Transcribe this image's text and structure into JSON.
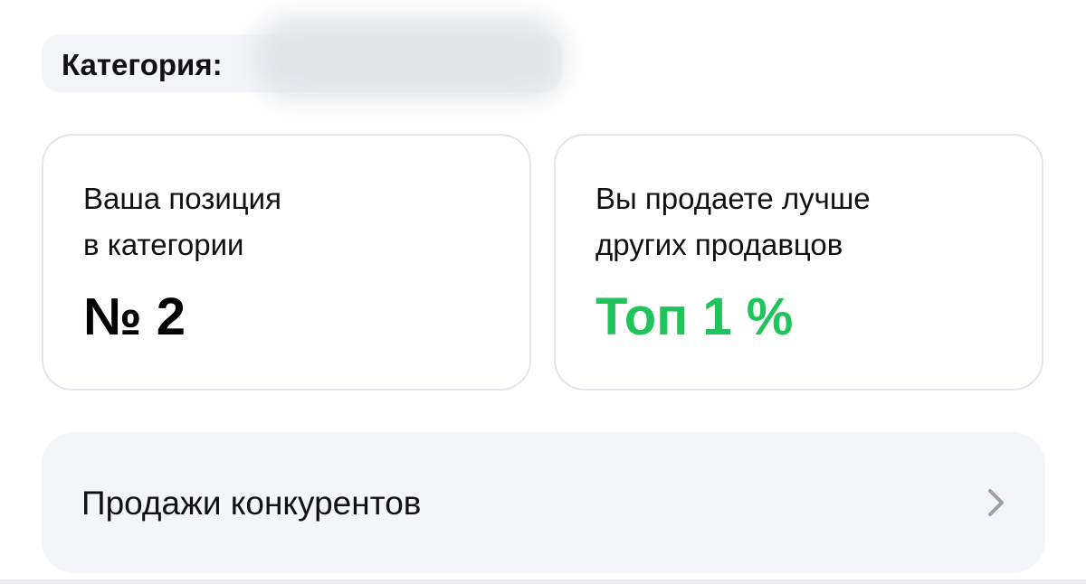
{
  "category": {
    "label": "Категория:"
  },
  "cards": [
    {
      "caption": "Ваша позиция\nв категории",
      "value": "№ 2"
    },
    {
      "caption": "Вы продаете лучше\nдругих продавцов",
      "value": "Топ 1 %"
    }
  ],
  "competitors": {
    "label": "Продажи конкурентов",
    "icon": "chevron-right-icon"
  },
  "colors": {
    "accent_green": "#1fc45a",
    "chip_background": "#f3f5f8",
    "card_border": "#dfe6ee",
    "chevron": "#9aa1ad"
  }
}
